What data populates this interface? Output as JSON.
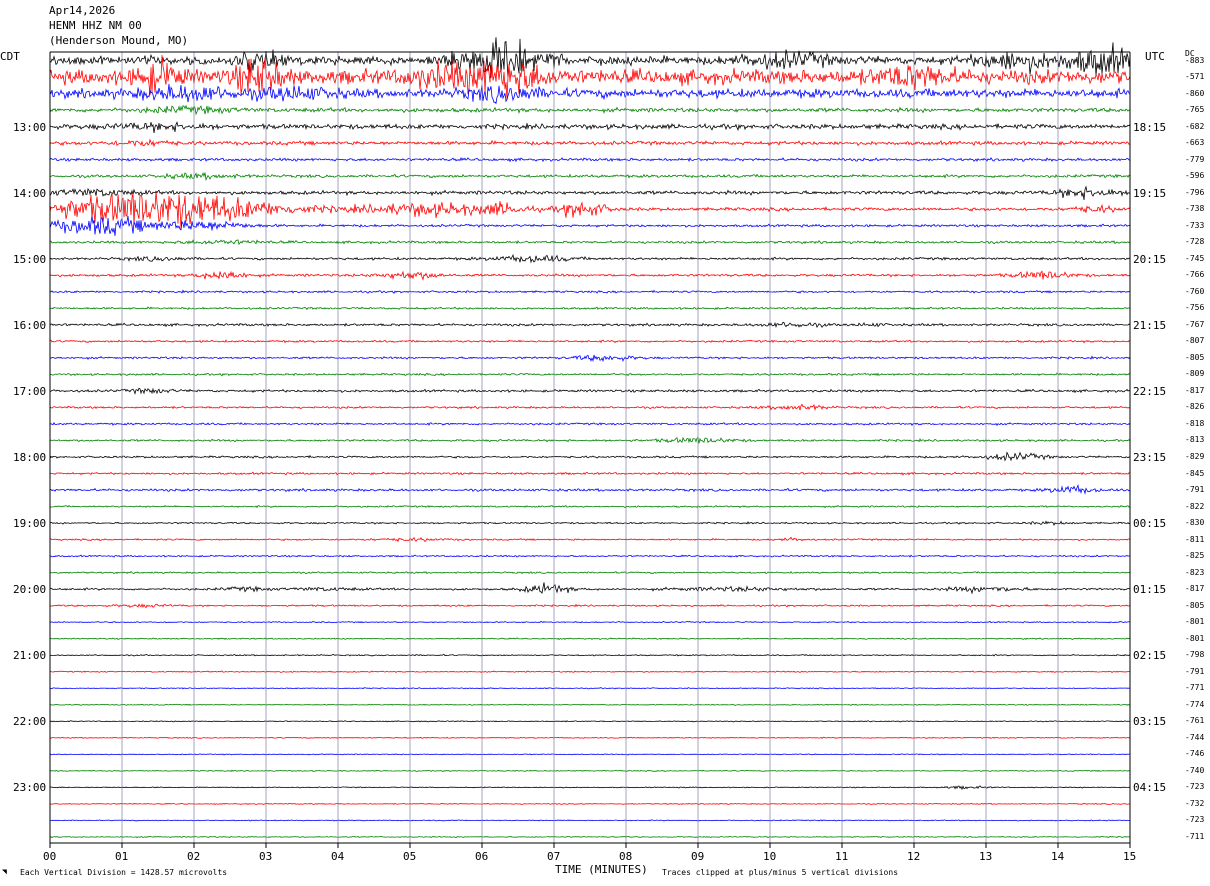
{
  "header": {
    "date": "Apr14,2026",
    "station": "HENM HHZ NM 00",
    "location": "(Henderson Mound, MO)"
  },
  "left_axis_label": "CDT",
  "right_axis_label": "UTC",
  "dc_label": "DC",
  "footer": {
    "scale_note": "Each Vertical Division = 1428.57 microvolts",
    "x_axis_title": "TIME (MINUTES)",
    "clip_note": "Traces clipped at plus/minus 5 vertical divisions"
  },
  "colors": {
    "trace_colors": [
      "#000000",
      "#ff0000",
      "#0000ff",
      "#008000"
    ],
    "gridline": "#8080a0"
  },
  "chart_data": {
    "type": "line",
    "chart_kind": "helicorder seismogram",
    "x_unit": "minutes",
    "x_range": [
      0,
      15
    ],
    "x_ticks": [
      "00",
      "01",
      "02",
      "03",
      "04",
      "05",
      "06",
      "07",
      "08",
      "09",
      "10",
      "11",
      "12",
      "13",
      "14",
      "15"
    ],
    "rows_per_hour": 4,
    "row_minutes": 15,
    "left_time_labels": [
      "13:00",
      "14:00",
      "15:00",
      "16:00",
      "17:00",
      "18:00",
      "19:00",
      "20:00",
      "21:00",
      "22:00",
      "23:00"
    ],
    "right_time_labels": [
      "18:15",
      "19:15",
      "20:15",
      "21:15",
      "22:15",
      "23:15",
      "00:15",
      "01:15",
      "02:15",
      "03:15",
      "04:15"
    ],
    "rows": [
      {
        "dc": "-883",
        "noise": 1.0,
        "events": [
          [
            6.3,
            4.0,
            0.6
          ],
          [
            2.9,
            2.0,
            0.3
          ],
          [
            14.6,
            3.0,
            0.5
          ],
          [
            10.2,
            1.5,
            0.6
          ],
          [
            13.4,
            2.0,
            0.5
          ]
        ]
      },
      {
        "dc": "-571",
        "noise": 1.8,
        "events": [
          [
            6.3,
            4.0,
            0.5
          ],
          [
            2.9,
            4.0,
            0.3
          ],
          [
            1.5,
            3.0,
            0.3
          ],
          [
            5.4,
            2.0,
            0.4
          ],
          [
            12.0,
            2.0,
            0.5
          ]
        ]
      },
      {
        "dc": "-860",
        "noise": 1.1,
        "events": [
          [
            1.9,
            1.5,
            0.6
          ],
          [
            6.3,
            1.5,
            0.5
          ],
          [
            3.4,
            1.2,
            0.5
          ]
        ]
      },
      {
        "dc": "-765",
        "noise": 0.5,
        "events": [
          [
            1.9,
            0.6,
            0.6
          ]
        ]
      },
      {
        "dc": "-682",
        "noise": 0.6,
        "events": [
          [
            1.5,
            0.7,
            0.6
          ]
        ]
      },
      {
        "dc": "-663",
        "noise": 0.45,
        "events": [
          [
            1.3,
            0.6,
            0.4
          ]
        ]
      },
      {
        "dc": "-779",
        "noise": 0.35,
        "events": []
      },
      {
        "dc": "-596",
        "noise": 0.35,
        "events": [
          [
            2.1,
            0.5,
            0.5
          ]
        ]
      },
      {
        "dc": "-796",
        "noise": 0.45,
        "events": [
          [
            0.6,
            0.7,
            0.6
          ],
          [
            14.4,
            1.2,
            0.4
          ]
        ]
      },
      {
        "dc": "-738",
        "noise": 0.4,
        "events": [
          [
            1.5,
            4.5,
            1.5
          ],
          [
            5.3,
            1.5,
            0.9
          ],
          [
            7.4,
            2.0,
            0.3
          ],
          [
            6.3,
            1.0,
            0.3
          ],
          [
            14.5,
            0.7,
            0.3
          ]
        ]
      },
      {
        "dc": "-733",
        "noise": 0.3,
        "events": [
          [
            0.7,
            2.2,
            0.7
          ],
          [
            2.1,
            1.2,
            0.6
          ]
        ]
      },
      {
        "dc": "-728",
        "noise": 0.3,
        "events": [
          [
            2.4,
            0.4,
            0.6
          ]
        ]
      },
      {
        "dc": "-745",
        "noise": 0.3,
        "events": [
          [
            6.7,
            0.8,
            0.5
          ],
          [
            1.5,
            0.4,
            0.4
          ]
        ]
      },
      {
        "dc": "-766",
        "noise": 0.3,
        "events": [
          [
            5.0,
            0.9,
            0.4
          ],
          [
            13.8,
            0.9,
            0.4
          ],
          [
            2.4,
            1.2,
            0.3
          ]
        ]
      },
      {
        "dc": "-760",
        "noise": 0.25,
        "events": []
      },
      {
        "dc": "-756",
        "noise": 0.25,
        "events": []
      },
      {
        "dc": "-767",
        "noise": 0.3,
        "events": [
          [
            10.3,
            0.5,
            0.4
          ],
          [
            11.4,
            0.3,
            0.2
          ]
        ]
      },
      {
        "dc": "-807",
        "noise": 0.25,
        "events": []
      },
      {
        "dc": "-805",
        "noise": 0.25,
        "events": [
          [
            7.7,
            0.7,
            0.4
          ]
        ]
      },
      {
        "dc": "-809",
        "noise": 0.25,
        "events": []
      },
      {
        "dc": "-817",
        "noise": 0.3,
        "events": [
          [
            1.4,
            0.5,
            0.3
          ]
        ]
      },
      {
        "dc": "-826",
        "noise": 0.25,
        "events": [
          [
            10.4,
            0.6,
            0.4
          ]
        ]
      },
      {
        "dc": "-818",
        "noise": 0.25,
        "events": []
      },
      {
        "dc": "-813",
        "noise": 0.25,
        "events": [
          [
            9.0,
            0.6,
            0.5
          ]
        ]
      },
      {
        "dc": "-829",
        "noise": 0.25,
        "events": [
          [
            13.4,
            0.8,
            0.4
          ]
        ]
      },
      {
        "dc": "-845",
        "noise": 0.25,
        "events": []
      },
      {
        "dc": "-791",
        "noise": 0.3,
        "events": [
          [
            14.2,
            0.9,
            0.3
          ]
        ]
      },
      {
        "dc": "-822",
        "noise": 0.2,
        "events": []
      },
      {
        "dc": "-830",
        "noise": 0.2,
        "events": [
          [
            13.9,
            0.3,
            0.3
          ]
        ]
      },
      {
        "dc": "-811",
        "noise": 0.2,
        "events": [
          [
            5.0,
            0.3,
            0.5
          ],
          [
            10.3,
            0.3,
            0.2
          ]
        ]
      },
      {
        "dc": "-825",
        "noise": 0.2,
        "events": []
      },
      {
        "dc": "-823",
        "noise": 0.2,
        "events": []
      },
      {
        "dc": "-817",
        "noise": 0.25,
        "events": [
          [
            6.9,
            1.2,
            0.3
          ],
          [
            9.5,
            0.4,
            0.8
          ],
          [
            13.0,
            0.6,
            0.5
          ],
          [
            2.7,
            0.4,
            0.3
          ],
          [
            3.8,
            0.3,
            0.5
          ]
        ]
      },
      {
        "dc": "-805",
        "noise": 0.2,
        "events": [
          [
            1.3,
            0.3,
            0.4
          ]
        ]
      },
      {
        "dc": "-801",
        "noise": 0.15,
        "events": []
      },
      {
        "dc": "-801",
        "noise": 0.15,
        "events": []
      },
      {
        "dc": "-798",
        "noise": 0.15,
        "events": []
      },
      {
        "dc": "-791",
        "noise": 0.15,
        "events": []
      },
      {
        "dc": "-771",
        "noise": 0.12,
        "events": []
      },
      {
        "dc": "-774",
        "noise": 0.12,
        "events": []
      },
      {
        "dc": "-761",
        "noise": 0.12,
        "events": []
      },
      {
        "dc": "-744",
        "noise": 0.12,
        "events": []
      },
      {
        "dc": "-746",
        "noise": 0.12,
        "events": []
      },
      {
        "dc": "-740",
        "noise": 0.12,
        "events": []
      },
      {
        "dc": "-723",
        "noise": 0.12,
        "events": [
          [
            12.7,
            0.3,
            0.3
          ]
        ]
      },
      {
        "dc": "-732",
        "noise": 0.12,
        "events": []
      },
      {
        "dc": "-723",
        "noise": 0.12,
        "events": []
      },
      {
        "dc": "-711",
        "noise": 0.12,
        "events": []
      }
    ]
  }
}
